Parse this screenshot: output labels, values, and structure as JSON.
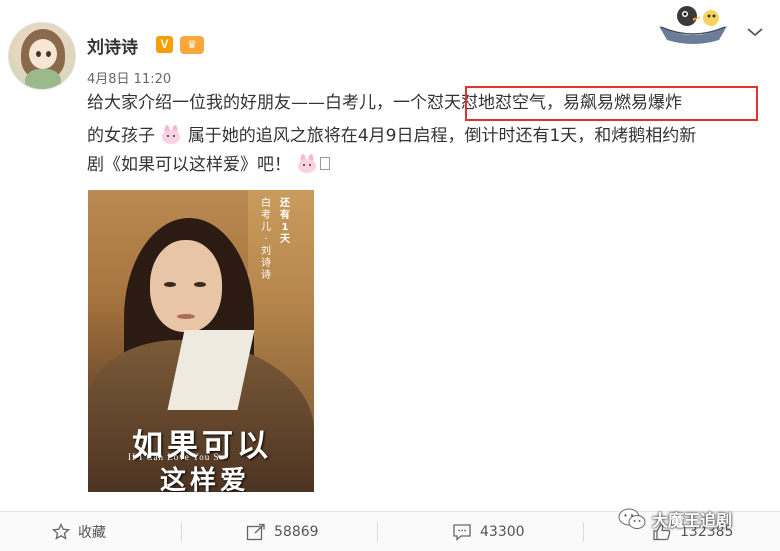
{
  "post": {
    "author": "刘诗诗",
    "verified_badge": "V",
    "member_badge": "♛",
    "timestamp": "4月8日 11:20",
    "line1": "给大家介绍一位我的好朋友——白考儿，一个怼天怼地怼空气，易飙易燃易爆炸",
    "line2": "的女孩子",
    "line2b": "属于她的追风之旅将在4月9日启程，倒计时还有1天，和烤鹅相约新",
    "line3": "剧《如果可以这样爱》吧！"
  },
  "poster": {
    "vertical_caption": "白考儿·刘诗诗",
    "countdown": "还有1天",
    "title_line1": "如果可以",
    "english_subtitle": "If I Can Love You So",
    "title_line2": "这样爱"
  },
  "actions": {
    "favorite_label": "收藏",
    "repost_count": "58869",
    "comment_count": "43300",
    "like_count": "132385"
  },
  "watermark": {
    "text": "大魔王追剧"
  },
  "colors": {
    "highlight_box": "#e23232",
    "verified": "#f3a000"
  },
  "icons": [
    "star-icon",
    "repost-icon",
    "comment-icon",
    "like-icon",
    "chevron-down-icon",
    "wechat-icon"
  ]
}
